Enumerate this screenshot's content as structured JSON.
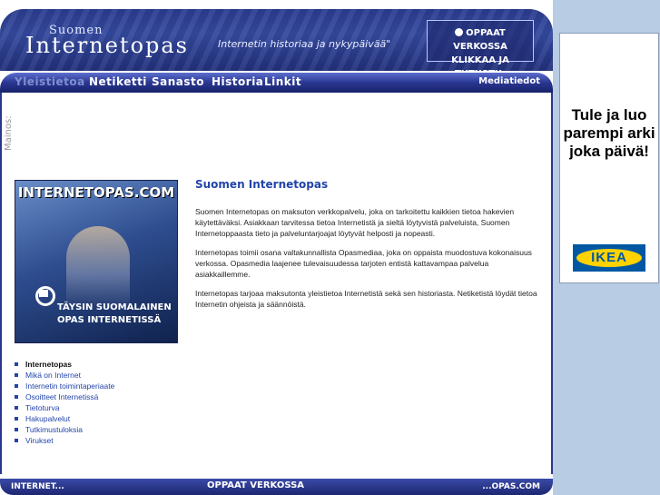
{
  "header": {
    "logo_small": "Suomen",
    "logo_main": "Internetopas",
    "tagline": "Internetin historiaa ja nykypäivää\"",
    "promo_line1": "OPPAAT VERKOSSA",
    "promo_line2": "KLIKKAA JA TUTUSTU:"
  },
  "nav": {
    "active": "Yleistietoa",
    "items": [
      "Netiketti",
      "Sanasto",
      "Historia",
      "Linkit"
    ],
    "media": "Mediatiedot"
  },
  "sidebar_label": "Mainos:",
  "promo": {
    "title": "INTERNETOPAS.COM",
    "line1": "TÄYSIN SUOMALAINEN",
    "line2": "OPAS INTERNETISSÄ"
  },
  "content": {
    "title": "Suomen Internetopas",
    "paragraphs": [
      "Suomen Internetopas on maksuton verkkopalvelu, joka on tarkoitettu kaikkien tietoa hakevien käytettäväksi. Asiakkaan tarvitessa tietoa Internetistä ja sieltä löytyvistä palveluista, Suomen Internetoppaasta tieto ja palveluntarjoajat löytyvät helposti ja nopeasti.",
      "Internetopas toimii osana valtakunnallista Opasmediaa, joka on oppaista muodostuva kokonaisuus verkossa. Opasmedia laajenee tulevaisuudessa tarjoten entistä kattavampaa palvelua asiakkaillemme.",
      "Internetopas tarjoaa maksutonta yleistietoa Internetistä sekä sen historiasta. Netiketistä löydät tietoa Internetin ohjeista ja säännöistä."
    ]
  },
  "menu": [
    "Internetopas",
    "Mikä on Internet",
    "Internetin toimintaperiaate",
    "Osoitteet Internetissä",
    "Tietoturva",
    "Hakupalvelut",
    "Tutkimustuloksia",
    "Virukset"
  ],
  "footer": {
    "left": "INTERNET...",
    "mid": "OPPAAT VERKOSSA",
    "right": "...OPAS.COM"
  },
  "ad": {
    "text": "Tule ja luo parempi arki joka päivä!",
    "logo": "IKEA"
  }
}
